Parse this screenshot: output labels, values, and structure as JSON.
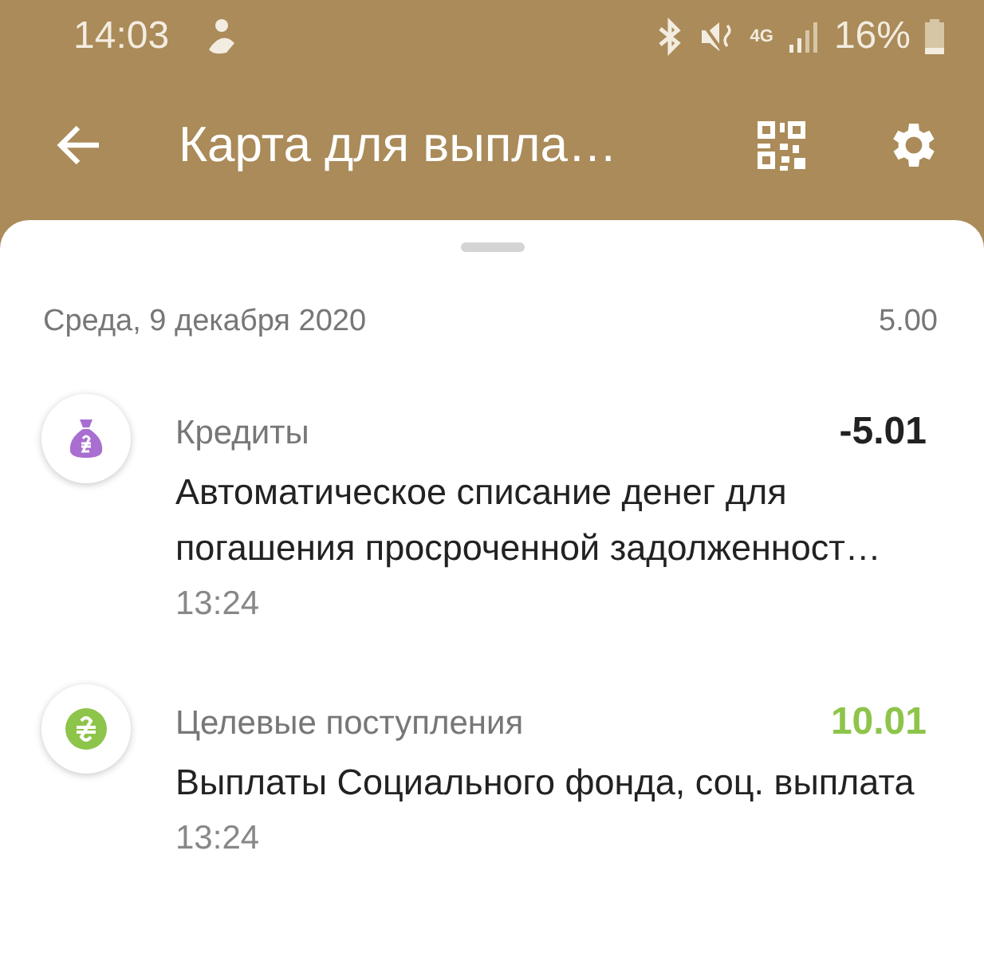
{
  "status_bar": {
    "time": "14:03",
    "battery": "16%",
    "network": "4G"
  },
  "app_bar": {
    "title": "Карта для выпла…"
  },
  "day": {
    "date": "Среда, 9 декабря 2020",
    "total": "5.00"
  },
  "transactions": [
    {
      "kind": "bag",
      "color": "#a86fd0",
      "category": "Кредиты",
      "amount": "-5.01",
      "incoming": false,
      "description": "Автоматическое списание денег для погашения просроченной задолженност…",
      "time": "13:24"
    },
    {
      "kind": "coin",
      "color": "#8dc44a",
      "category": "Целевые поступления",
      "amount": "10.01",
      "incoming": true,
      "description": "Выплаты Социального фонда, соц. выплата",
      "time": "13:24"
    }
  ]
}
